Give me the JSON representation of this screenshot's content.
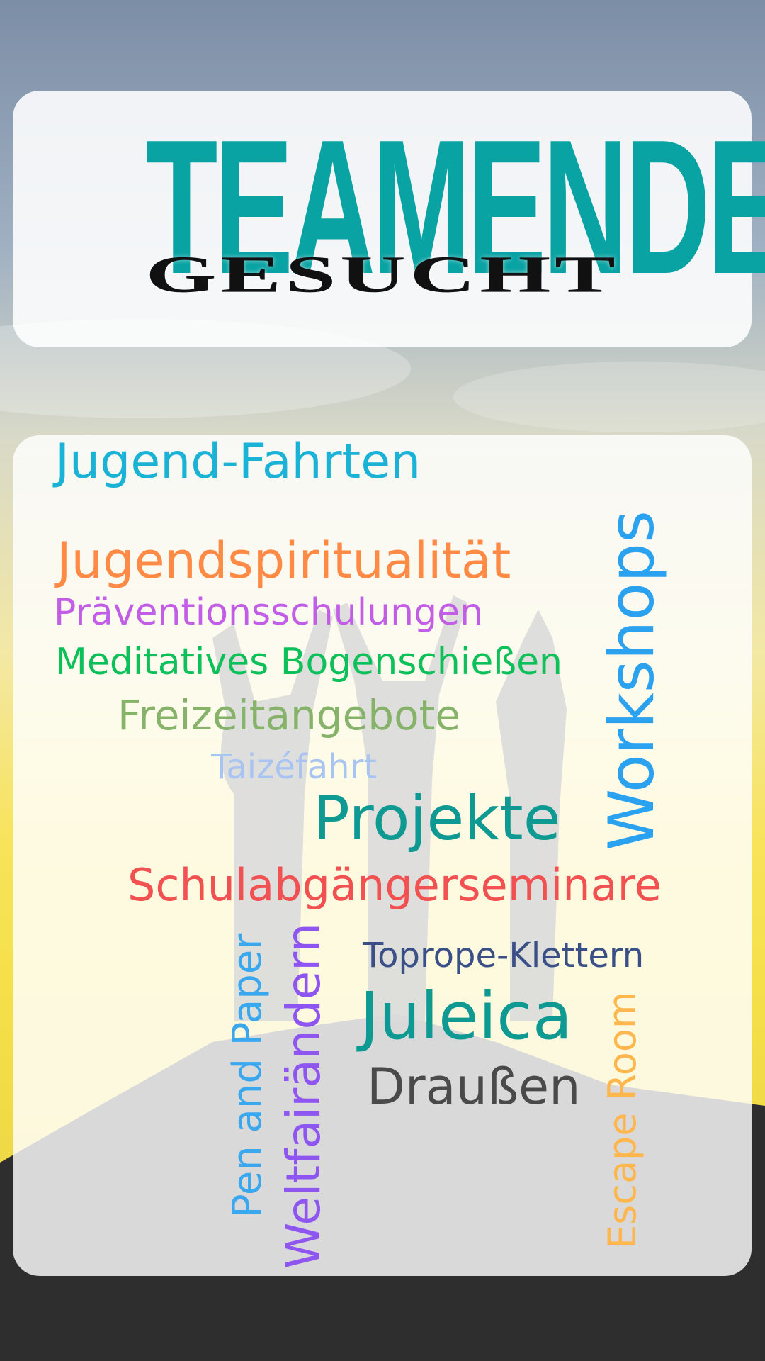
{
  "header": {
    "title": "TEAMENDE",
    "subtitle": "GESUCHT"
  },
  "colors": {
    "title": "#0aa3a3",
    "subtitle": "#111111",
    "ground": "#2e2e2e"
  },
  "word_cloud": [
    {
      "text": "Jugend-Fahrten",
      "color": "#1ab3d6"
    },
    {
      "text": "Jugendspiritualität",
      "color": "#ff8a45"
    },
    {
      "text": "Präventionsschulungen",
      "color": "#c25ee6"
    },
    {
      "text": "Meditatives Bogenschießen",
      "color": "#0ec05a"
    },
    {
      "text": "Freizeitangebote",
      "color": "#86b26a"
    },
    {
      "text": "Taizéfahrt",
      "color": "#a9c4f0"
    },
    {
      "text": "Projekte",
      "color": "#0e9a92"
    },
    {
      "text": "Schulabgängerseminare",
      "color": "#f25151"
    },
    {
      "text": "Toprope-Klettern",
      "color": "#3a4f86"
    },
    {
      "text": "Juleica",
      "color": "#0e9a92"
    },
    {
      "text": "Draußen",
      "color": "#4a4a4a"
    },
    {
      "text": "Workshops",
      "color": "#2aa2ef"
    },
    {
      "text": "Pen and Paper",
      "color": "#39a8ee"
    },
    {
      "text": "Weltfairändern",
      "color": "#8f55f0"
    },
    {
      "text": "Escape Room",
      "color": "#ffb74d"
    }
  ]
}
